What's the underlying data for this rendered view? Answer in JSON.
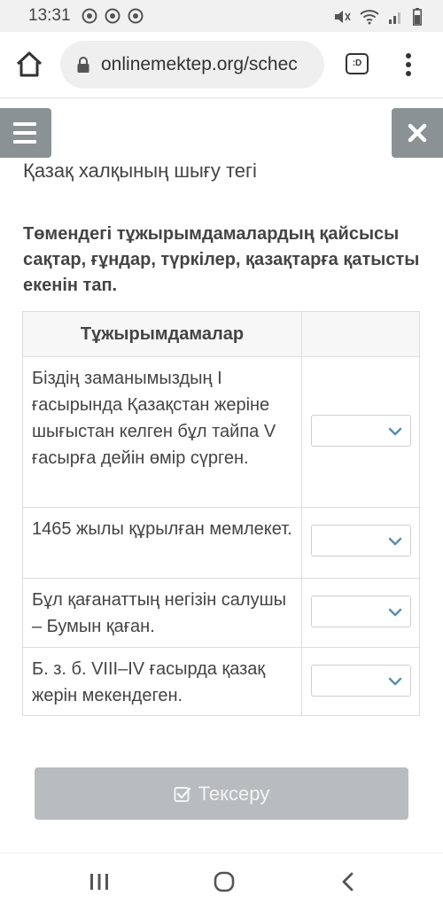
{
  "status": {
    "time": "13:31"
  },
  "browser": {
    "url": "onlinemektep.org/schec",
    "tabs_label": ":D"
  },
  "page": {
    "title": "Қазақ халқының шығу тегі",
    "question": "Төмендегі тұжырымдамалардың қайсысы сақтар, ғұндар, түркілер, қазақтарға қатысты екенін тап.",
    "table": {
      "header": "Тұжырымдамалар",
      "rows": [
        {
          "text": "Біздің заманымыздың I ғасырында Қазақстан жеріне шығыстан келген бұл тайпа V ғасырға дейін өмір сүрген.",
          "selected": ""
        },
        {
          "text": "1465 жылы құрылған мемлекет.",
          "selected": ""
        },
        {
          "text": "Бұл қағанаттың негізін салушы – Бумын қаған.",
          "selected": ""
        },
        {
          "text": "Б. з. б. VIII–IV ғасырда қазақ жерін мекендеген.",
          "selected": ""
        }
      ]
    },
    "check_button": "Тексеру"
  },
  "icons": {
    "home": "home-icon",
    "lock": "lock-icon",
    "menu": "more-vert-icon",
    "hamburger": "hamburger-icon",
    "close": "close-icon",
    "chevron": "chevron-down-icon",
    "check": "checkbox-icon",
    "recents": "recents-icon",
    "nav_home": "nav-home-icon",
    "back": "back-icon"
  },
  "colors": {
    "side_button": "#8b9294",
    "check_button": "#b8bcbe",
    "chevron": "#5b8fb0"
  }
}
